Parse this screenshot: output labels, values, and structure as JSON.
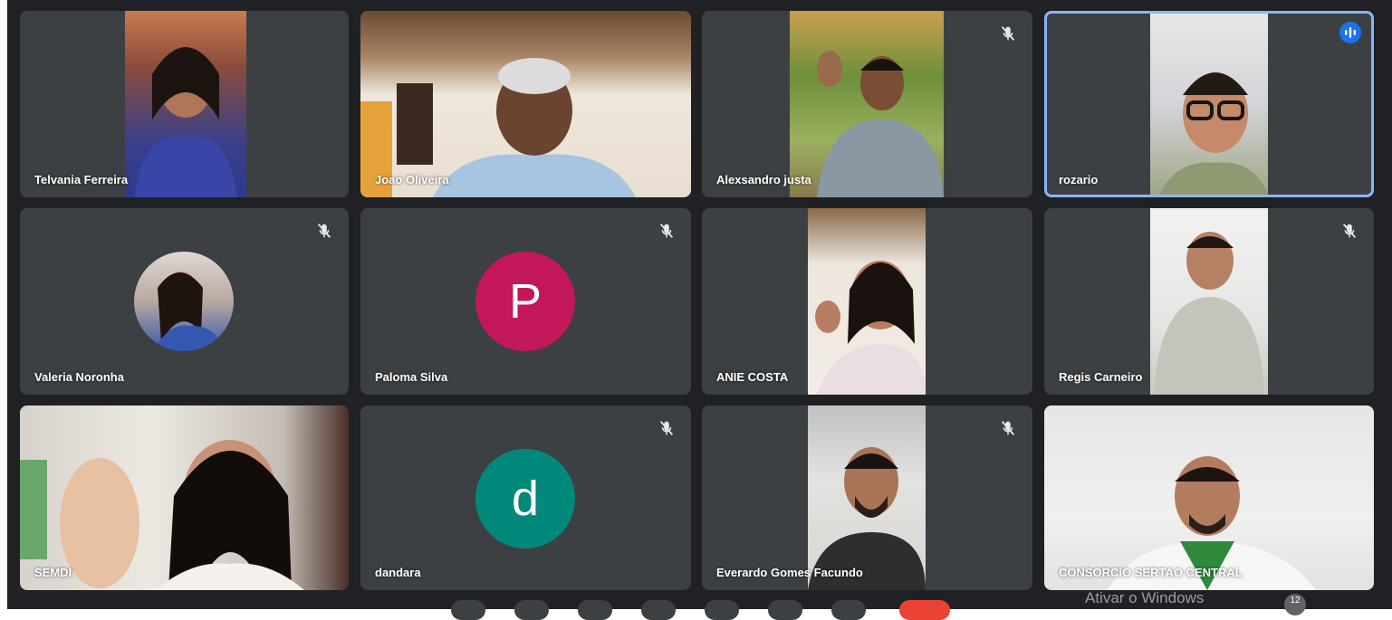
{
  "participants": [
    {
      "name": "Telvania Ferreira",
      "muted": false
    },
    {
      "name": "Joao Oliveira",
      "muted": false
    },
    {
      "name": "Alexsandro justa",
      "muted": true
    },
    {
      "name": "rozario",
      "muted": false,
      "speaking": true
    },
    {
      "name": "Valeria Noronha",
      "muted": true
    },
    {
      "name": "Paloma Silva",
      "muted": true,
      "avatar_letter": "P",
      "avatar_color": "#c2185b"
    },
    {
      "name": "ANIE COSTA",
      "muted": false
    },
    {
      "name": "Regis Carneiro",
      "muted": true
    },
    {
      "name": "SEMDI",
      "muted": false
    },
    {
      "name": "dandara",
      "muted": true,
      "avatar_letter": "d",
      "avatar_color": "#00897b"
    },
    {
      "name": "Everardo Gomes Facundo",
      "muted": true
    },
    {
      "name": "CONSORCIO SERTAO CENTRAL",
      "muted": false
    }
  ],
  "icons": {
    "muted": "mic-off-icon",
    "speaking": "audio-wave-icon"
  },
  "colors": {
    "background": "#202124",
    "tile": "#3c4043",
    "active_border": "#8ab4f8",
    "leave": "#ea4335"
  },
  "watermark": "Ativar o Windows",
  "participant_count": "12"
}
